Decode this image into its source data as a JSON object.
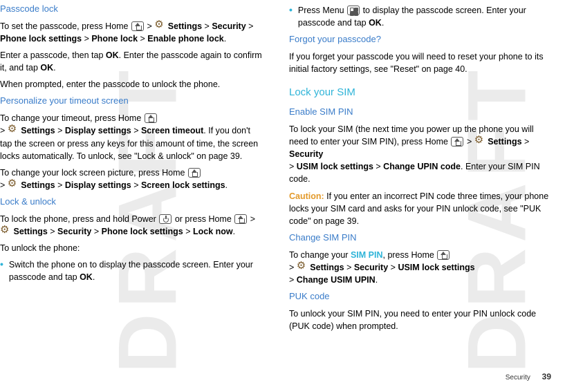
{
  "watermark": "DRAFT",
  "left": {
    "h1": "Passcode lock",
    "p1a": "To set the passcode, press Home",
    "p1b": ">",
    "p1c": "Settings",
    "p1d": "Security",
    "p1e": "Phone lock settings",
    "p1f": "Phone lock",
    "p1g": "Enable phone lock",
    "p2a": "Enter a passcode, then tap ",
    "p2b": "OK",
    "p2c": ". Enter the passcode again to confirm it, and tap ",
    "p2d": "OK",
    "p3": "When prompted, enter the passcode to unlock the phone.",
    "h2": "Personalize your timeout screen",
    "p4a": "To change your timeout, press Home",
    "p4b": ">",
    "p4c": "Settings",
    "p4d": "Display settings",
    "p4e": "Screen timeout",
    "p4f": ". If you don't tap the screen or press any keys for this amount of time, the screen locks automatically. To unlock, see \"Lock & unlock\" on page 39.",
    "p5a": "To change your lock screen picture, press Home",
    "p5b": ">",
    "p5c": "Settings",
    "p5d": "Display settings",
    "p5e": "Screen lock settings",
    "h3": "Lock & unlock",
    "p6a": "To lock the phone, press and hold Power",
    "p6b": "or press Home",
    "p6c": ">",
    "p6d": "Settings",
    "p6e": "Security",
    "p6f": "Phone lock settings",
    "p6g": "Lock now",
    "p7": "To unlock the phone:",
    "b1a": "Switch the phone on to display the passcode screen. Enter your passcode and tap ",
    "b1b": "OK"
  },
  "right": {
    "b2a": "Press Menu",
    "b2b": "to display the passcode screen. Enter your passcode and tap ",
    "b2c": "OK",
    "h4": "Forgot your passcode?",
    "p8": "If you forget your passcode you will need to reset your phone to its initial factory settings, see \"Reset\" on page 40.",
    "h5": "Lock your SIM",
    "h6": "Enable SIM PIN",
    "p9a": "To lock your SIM (the next time you power up the phone you will need to enter your SIM PIN), press Home",
    "p9b": ">",
    "p9c": "Settings",
    "p9d": "Security",
    "p9e": "USIM lock settings",
    "p9f": "Change UPIN code",
    "p9g": ". Enter your SIM PIN code.",
    "cautionLabel": "Caution:",
    "p10": " If you enter an incorrect PIN code three times, your phone locks your SIM card and asks for your PIN unlock code, see \"PUK code\" on page 39.",
    "h7": "Change SIM PIN",
    "p11a": "To change your ",
    "p11b": "SIM PIN",
    "p11c": ", press Home",
    "p11d": ">",
    "p11e": "Settings",
    "p11f": "Security",
    "p11g": "USIM lock settings",
    "p11h": "Change USIM UPIN",
    "h8": "PUK code",
    "p12": "To unlock your SIM PIN, you need to enter your PIN unlock code (PUK code) when prompted."
  },
  "footer": {
    "section": "Security",
    "page": "39"
  }
}
